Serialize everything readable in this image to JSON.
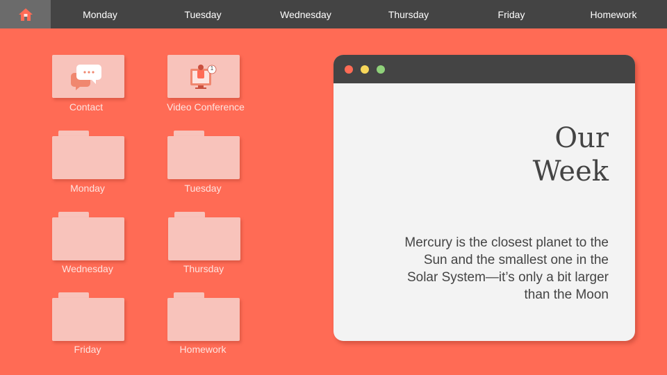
{
  "nav": {
    "home_icon": "home-icon",
    "items": [
      "Monday",
      "Tuesday",
      "Wednesday",
      "Thursday",
      "Friday",
      "Homework"
    ]
  },
  "desktop": {
    "apps": [
      {
        "label": "Contact",
        "icon": "chat-bubbles-icon"
      },
      {
        "label": "Video Conference",
        "icon": "video-conference-icon",
        "badge": "1"
      }
    ],
    "folders": [
      "Monday",
      "Tuesday",
      "Wednesday",
      "Thursday",
      "Friday",
      "Homework"
    ]
  },
  "window": {
    "title_line1": "Our",
    "title_line2": "Week",
    "body": "Mercury is the closest planet to the Sun and the smallest one in the Solar System—it’s only a bit larger than the Moon"
  },
  "colors": {
    "background": "#ff6b55",
    "bar": "#444444",
    "tile": "#f8c3bb",
    "window_bg": "#f3f3f3",
    "dot_red": "#ff6b55",
    "dot_yellow": "#f7d75a",
    "dot_green": "#8fd17a"
  }
}
